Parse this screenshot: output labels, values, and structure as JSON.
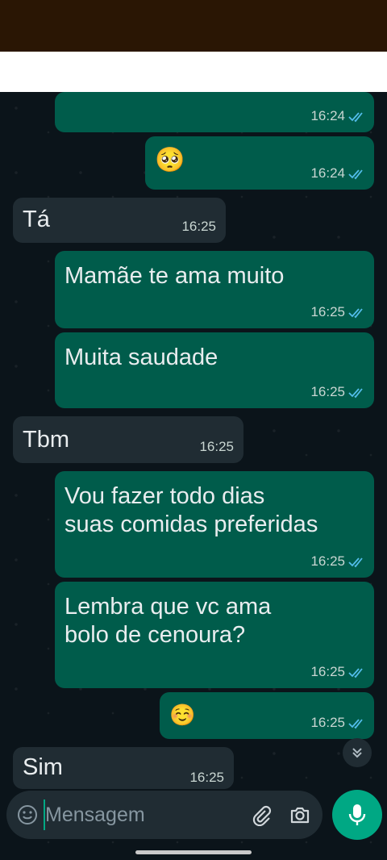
{
  "messages": [
    {
      "direction": "out",
      "text": "",
      "emoji": "",
      "time": "16:24"
    },
    {
      "direction": "out",
      "text": "",
      "emoji": "🥺",
      "time": "16:24"
    },
    {
      "direction": "in",
      "text": "Tá",
      "time": "16:25"
    },
    {
      "direction": "out",
      "text": "Mamãe te ama muito",
      "time": "16:25"
    },
    {
      "direction": "out",
      "text": "Muita saudade",
      "time": "16:25"
    },
    {
      "direction": "in",
      "text": "Tbm",
      "time": "16:25"
    },
    {
      "direction": "out",
      "text": "Vou fazer todo dias\nsuas comidas preferidas",
      "time": "16:25"
    },
    {
      "direction": "out",
      "text": "Lembra que vc ama\nbolo de cenoura?",
      "time": "16:25"
    },
    {
      "direction": "out",
      "text": "",
      "emoji": "☺️",
      "time": "16:25"
    },
    {
      "direction": "in",
      "text": "Sim",
      "time": "16:25"
    }
  ],
  "composer": {
    "placeholder": "Mensagem"
  },
  "icons": {
    "emoji": "emoji-icon",
    "attach": "paperclip-icon",
    "camera": "camera-icon",
    "mic": "microphone-icon",
    "scroll_down": "double-chevron-down-icon",
    "read": "double-check-icon"
  },
  "colors": {
    "outgoing": "#005c4b",
    "incoming": "#202c33",
    "accent": "#00a884",
    "read_ticks": "#53bdeb"
  }
}
